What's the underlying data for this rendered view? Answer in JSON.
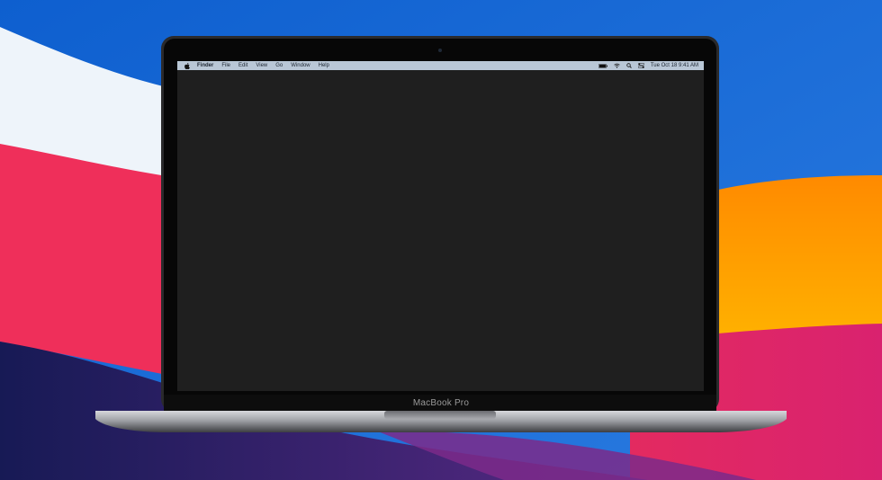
{
  "menubar": {
    "app_name": "Finder",
    "items": [
      "File",
      "Edit",
      "View",
      "Go",
      "Window",
      "Help"
    ],
    "clock": "Tue Oct 18  9:41 AM"
  },
  "device": {
    "model_label": "MacBook Pro"
  },
  "icons": {
    "apple": "apple-icon",
    "battery": "battery-icon",
    "wifi": "wifi-icon",
    "search": "search-icon",
    "control_center": "control-center-icon"
  },
  "colors": {
    "sky_blue": "#1668d0",
    "white_wave": "#eef4fa",
    "red_wave": "#ef2f5a",
    "orange_wave": "#ff8a00",
    "magenta_wave": "#e42c6a",
    "navy_wave": "#1c1e5c",
    "screen_bg": "#1f1f1f",
    "menubar_bg": "#b9c7d6"
  }
}
